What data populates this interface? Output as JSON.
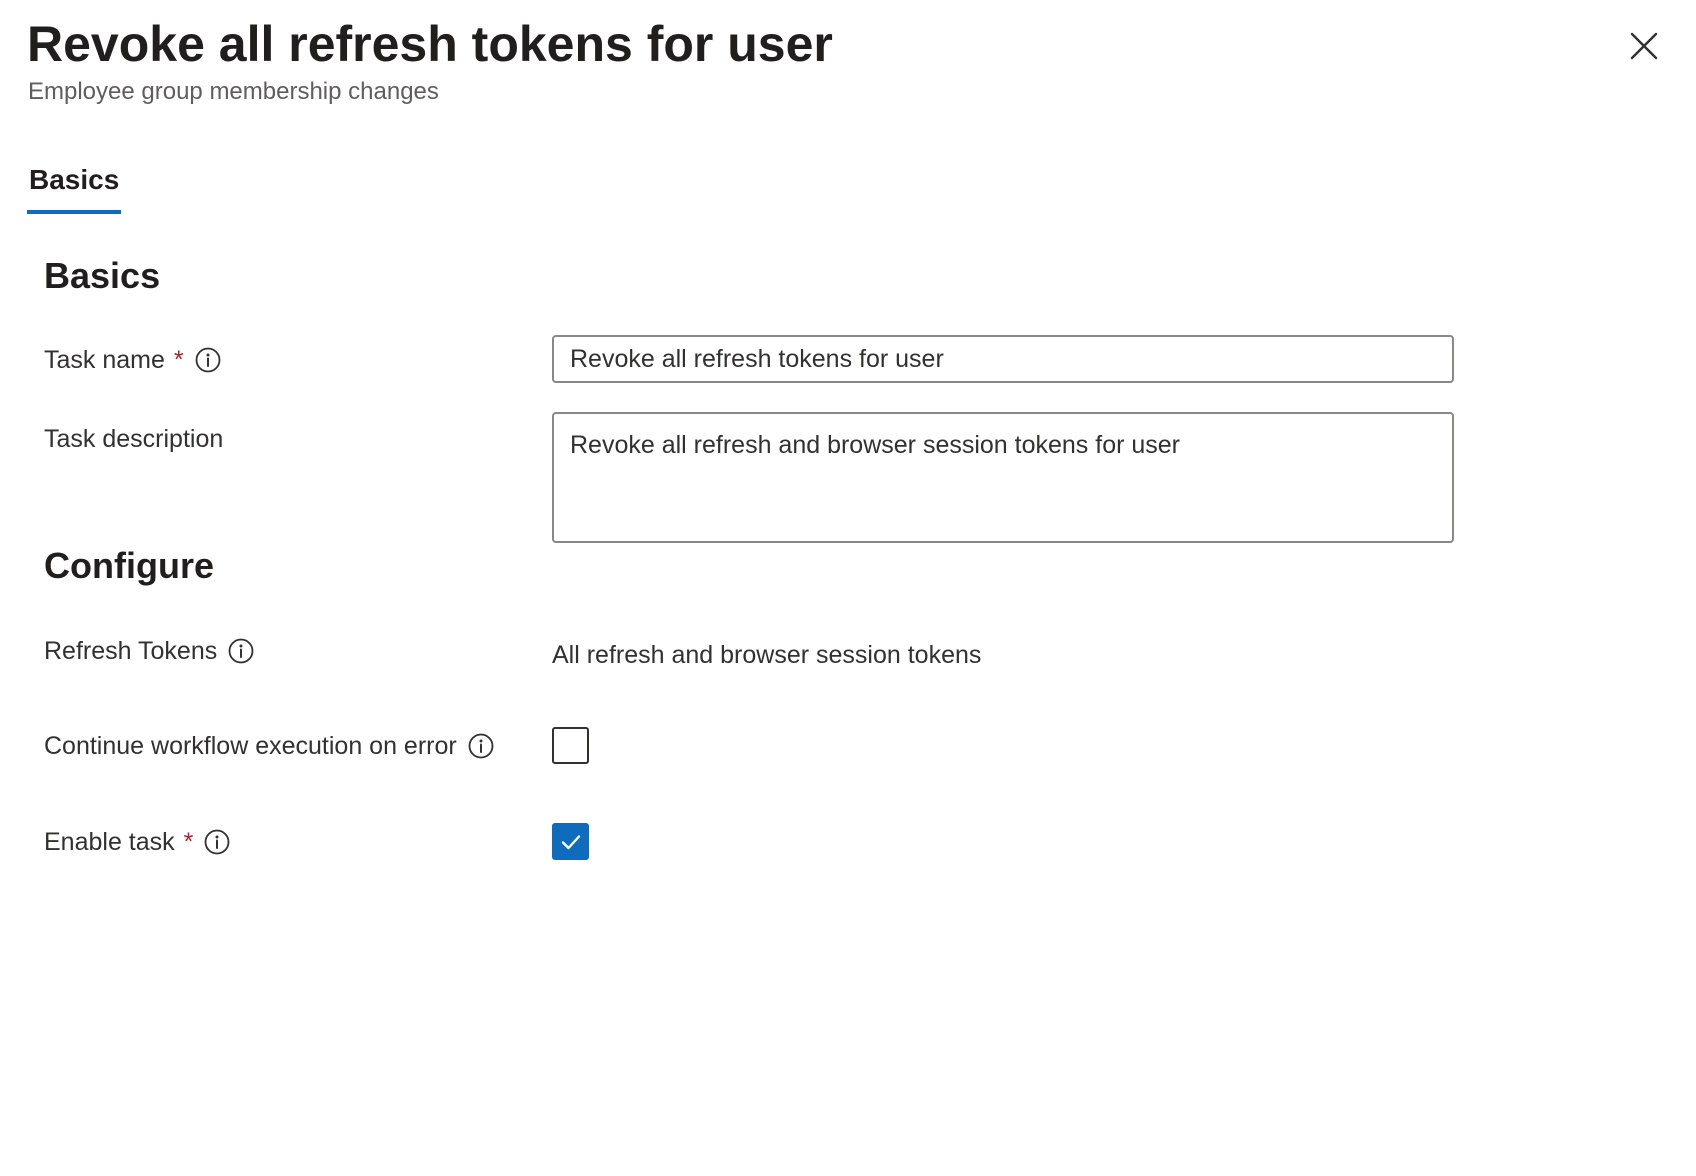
{
  "panel": {
    "title": "Revoke all refresh tokens for user",
    "subtitle": "Employee group membership changes",
    "close_icon": "close-icon"
  },
  "tabs": [
    {
      "label": "Basics",
      "selected": true
    }
  ],
  "basics": {
    "heading": "Basics",
    "task_name": {
      "label": "Task name",
      "required_marker": "*",
      "value": "Revoke all refresh tokens for user",
      "info_icon": "info-icon"
    },
    "task_description": {
      "label": "Task description",
      "value": "Revoke all refresh and browser session tokens for user"
    }
  },
  "configure": {
    "heading": "Configure",
    "refresh_tokens": {
      "label": "Refresh Tokens",
      "value": "All refresh and browser session tokens",
      "info_icon": "info-icon"
    },
    "continue_on_error": {
      "label": "Continue workflow execution on error",
      "checked": false,
      "info_icon": "info-icon"
    },
    "enable_task": {
      "label": "Enable task",
      "required_marker": "*",
      "checked": true,
      "info_icon": "info-icon"
    }
  },
  "colors": {
    "accent": "#0f6cbd",
    "required": "#a4262c",
    "text": "#323130",
    "border": "#8a8886"
  }
}
